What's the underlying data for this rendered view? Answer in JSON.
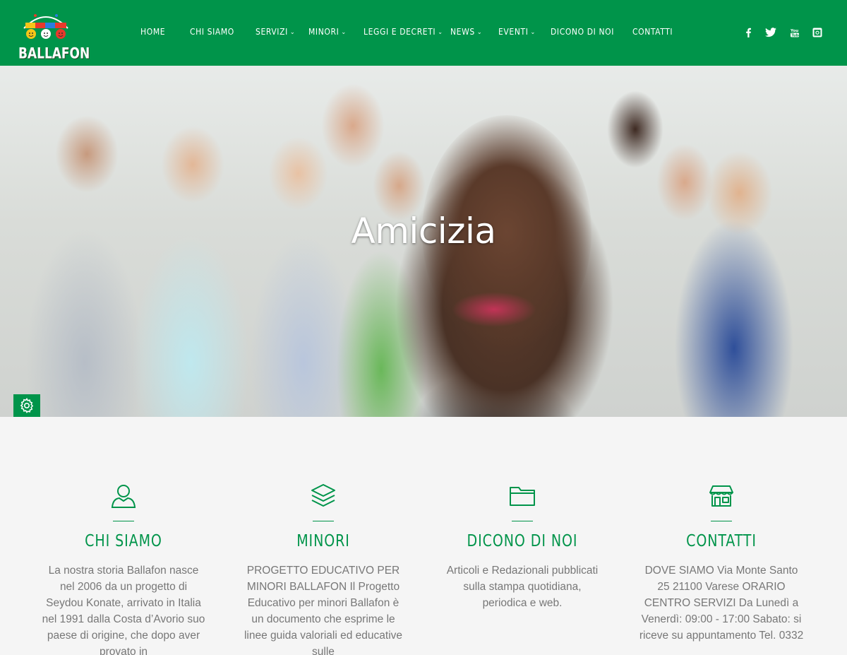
{
  "brand": {
    "logo_text": "BALLAFON",
    "accent": "#00944a"
  },
  "nav": [
    {
      "label": "HOME",
      "dropdown": false
    },
    {
      "label": "CHI SIAMO",
      "dropdown": false
    },
    {
      "label": "SERVIZI",
      "dropdown": true
    },
    {
      "label": "MINORI",
      "dropdown": true
    },
    {
      "label": "LEGGI E DECRETI",
      "dropdown": true
    },
    {
      "label": "NEWS",
      "dropdown": true
    },
    {
      "label": "EVENTI",
      "dropdown": true
    },
    {
      "label": "DICONO DI NOI",
      "dropdown": false
    },
    {
      "label": "CONTATTI",
      "dropdown": false
    }
  ],
  "social": [
    "facebook-icon",
    "twitter-icon",
    "youtube-icon",
    "instagram-icon"
  ],
  "hero": {
    "title": "Amicizia"
  },
  "features": [
    {
      "icon": "user-icon",
      "title": "CHI SIAMO",
      "text": "La nostra storia Ballafon nasce nel 2006 da un progetto di Seydou Konate, arrivato in Italia nel 1991 dalla Costa d’Avorio suo paese di origine, che dopo aver provato in"
    },
    {
      "icon": "layers-icon",
      "title": "MINORI",
      "text": "PROGETTO EDUCATIVO PER MINORI BALLAFON Il Progetto Educativo per minori Ballafon è un documento che esprime le linee guida valoriali ed educative sulle"
    },
    {
      "icon": "folder-icon",
      "title": "DICONO DI NOI",
      "text": "Articoli e Redazionali pubblicati sulla stampa quotidiana, periodica e web."
    },
    {
      "icon": "store-icon",
      "title": "CONTATTI",
      "text": "DOVE SIAMO Via Monte Santo 25 21100 Varese ORARIO CENTRO SERVIZI Da Lunedì a Venerdì: 09:00 - 17:00 Sabato: si riceve su appuntamento Tel. 0332"
    }
  ]
}
